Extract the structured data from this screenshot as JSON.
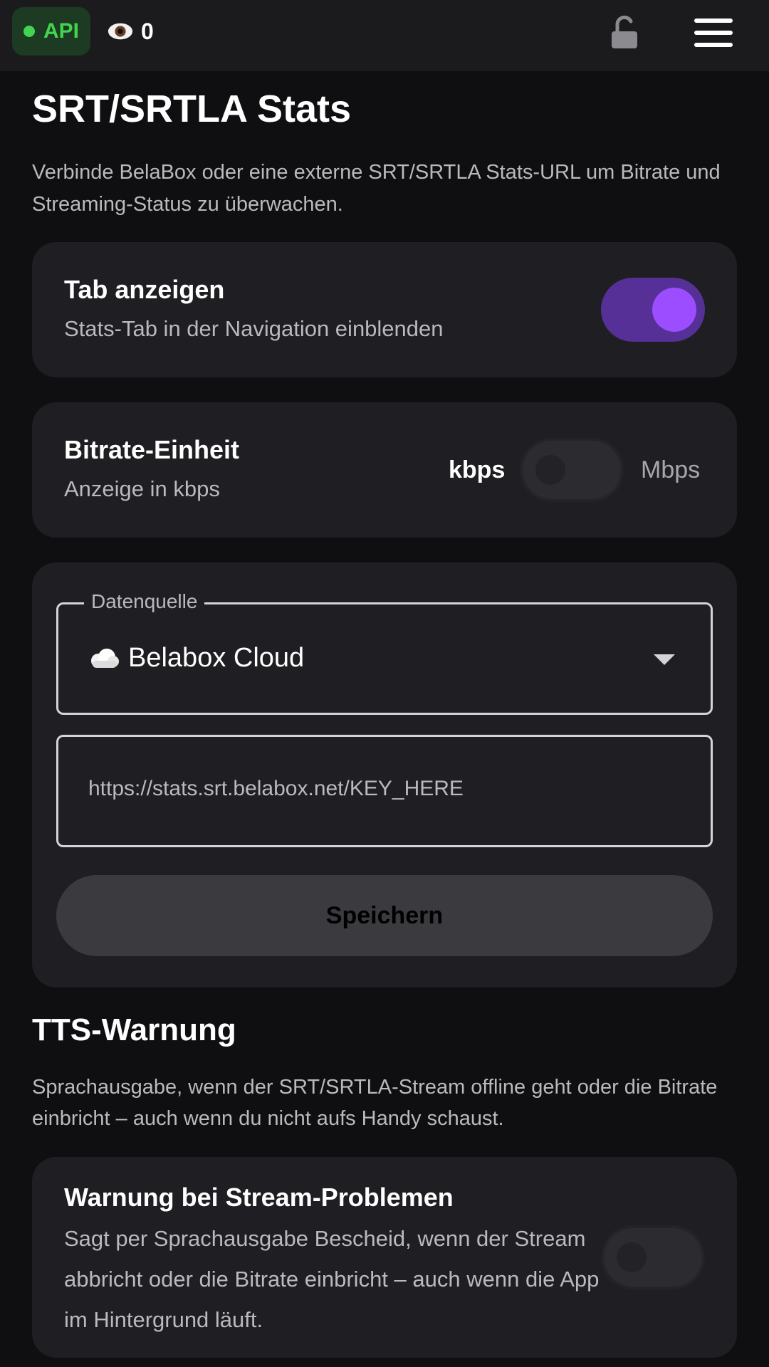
{
  "topbar": {
    "api_label": "API",
    "api_color": "#43d44f",
    "viewer_count": "0",
    "icons": [
      "eye-icon",
      "lock-open-icon",
      "hamburger-menu-icon"
    ]
  },
  "page": {
    "title": "SRT/SRTLA Stats",
    "description": "Verbinde BelaBox oder eine externe SRT/SRTLA Stats-URL um Bitrate und Streaming-Status zu überwachen."
  },
  "tab_card": {
    "title": "Tab anzeigen",
    "subtitle": "Stats-Tab in der Navigation einblenden",
    "toggle_on": true
  },
  "bitrate_card": {
    "title": "Bitrate-Einheit",
    "subtitle": "Anzeige in kbps",
    "unit_left": "kbps",
    "unit_right": "Mbps",
    "toggle_on": false
  },
  "source_card": {
    "select_label": "Datenquelle",
    "select_value": "Belabox Cloud",
    "url_placeholder": "https://stats.srt.belabox.net/KEY_HERE",
    "save_label": "Speichern"
  },
  "tts": {
    "title": "TTS-Warnung",
    "description": "Sprachausgabe, wenn der SRT/SRTLA-Stream offline geht oder die Bitrate einbricht – auch wenn du nicht aufs Handy schaust.",
    "card_title": "Warnung bei Stream-Problemen",
    "card_subtitle": "Sagt per Sprachausgabe Bescheid, wenn der Stream abbricht oder die Bitrate einbricht – auch wenn die App im Hintergrund läuft.",
    "toggle_on": false
  },
  "colors": {
    "accent": "#9b4dff",
    "accent_track": "#563096",
    "background": "#0f0f11",
    "card": "#1f1f23"
  }
}
